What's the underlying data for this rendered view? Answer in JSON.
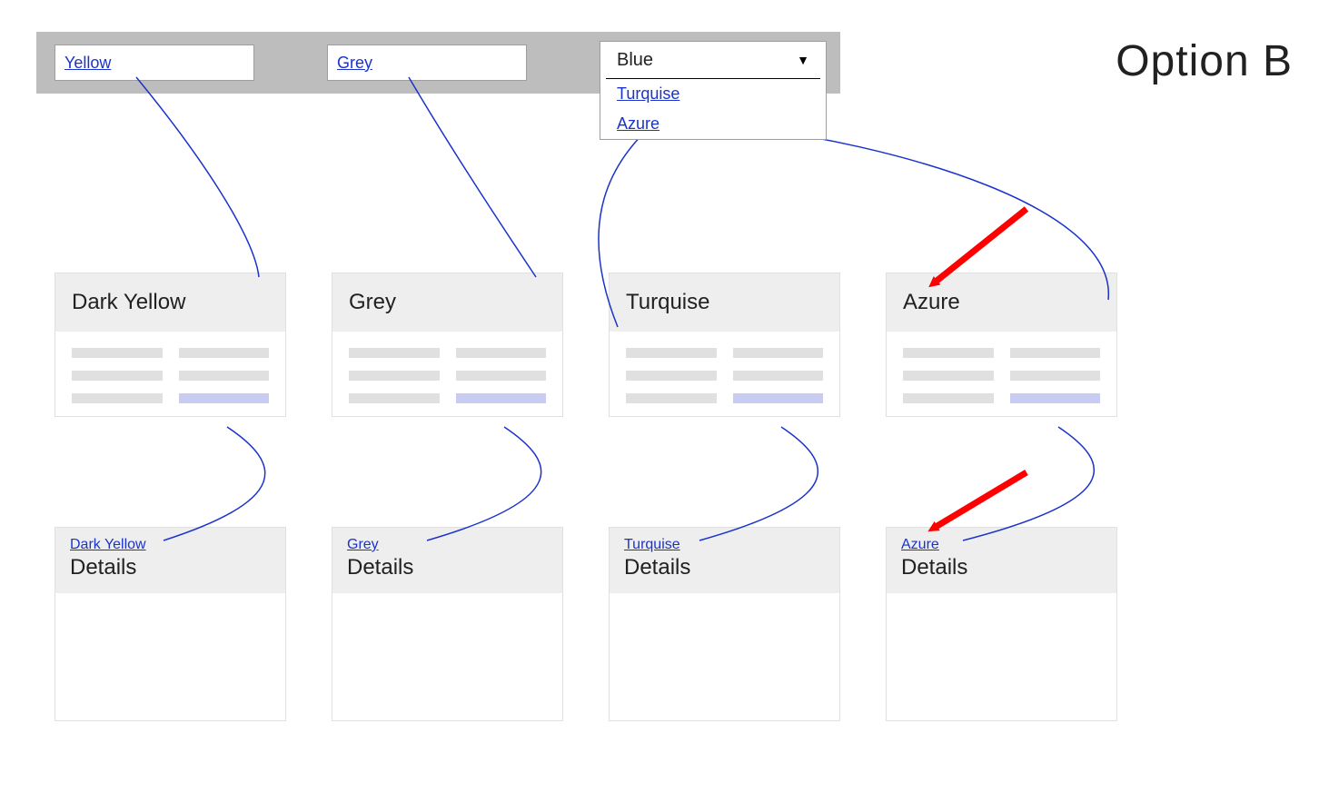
{
  "title": "Option B",
  "search": {
    "fields": [
      {
        "label": "Yellow"
      },
      {
        "label": "Grey"
      }
    ],
    "dropdown": {
      "selected": "Blue",
      "options": [
        "Turquise",
        "Azure"
      ]
    }
  },
  "cards": [
    {
      "title": "Dark Yellow"
    },
    {
      "title": "Grey"
    },
    {
      "title": "Turquise"
    },
    {
      "title": "Azure"
    }
  ],
  "details": [
    {
      "link": "Dark Yellow",
      "title": "Details"
    },
    {
      "link": "Grey",
      "title": "Details"
    },
    {
      "link": "Turquise",
      "title": "Details"
    },
    {
      "link": "Azure",
      "title": "Details"
    }
  ]
}
